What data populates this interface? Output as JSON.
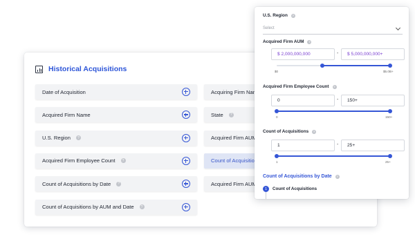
{
  "card": {
    "title": "Historical Acquisitions",
    "left_fields": [
      {
        "label": "Date of Acquisition",
        "info": false
      },
      {
        "label": "Acquired Firm Name",
        "info": false
      },
      {
        "label": "U.S. Region",
        "info": true
      },
      {
        "label": "Acquired Firm Employee Count",
        "info": true
      },
      {
        "label": "Count of Acquisitions by Date",
        "info": true
      },
      {
        "label": "Count of Acquisitions by AUM and Date",
        "info": true
      }
    ],
    "right_fields": [
      {
        "label": "Acquiring Firm Nam",
        "info": false,
        "highlight": false
      },
      {
        "label": "State",
        "info": true,
        "highlight": false
      },
      {
        "label": "Acquired Firm AUM",
        "info": false,
        "highlight": false
      },
      {
        "label": "Count of Acquisitio",
        "info": false,
        "highlight": true
      },
      {
        "label": "Acquired Firm AUM",
        "info": false,
        "highlight": false
      }
    ]
  },
  "panel": {
    "region": {
      "label": "U.S. Region",
      "placeholder": "Select"
    },
    "aum": {
      "label": "Acquired Firm AUM",
      "min": "$  2,000,000,000",
      "max": "$  5,000,000,000+",
      "tick_min": "$0",
      "tick_max": "$5.0B+",
      "range": [
        0.4,
        1.0
      ]
    },
    "employees": {
      "label": "Acquired Firm Employee Count",
      "min": "0",
      "max": "150+",
      "tick_min": "0",
      "tick_max": "150+",
      "range": [
        0.0,
        1.0
      ]
    },
    "count": {
      "label": "Count of Acquisitions",
      "min": "1",
      "max": "25+",
      "tick_min": "1",
      "tick_max": "25+",
      "range": [
        0.0,
        1.0
      ]
    },
    "section_title": "Count of Acquisitions by Date",
    "step_number": "1",
    "step_label": "Count of Acquisitions",
    "dash": "-"
  },
  "colors": {
    "accent": "#3556d6",
    "purple": "#7a3fd1"
  }
}
